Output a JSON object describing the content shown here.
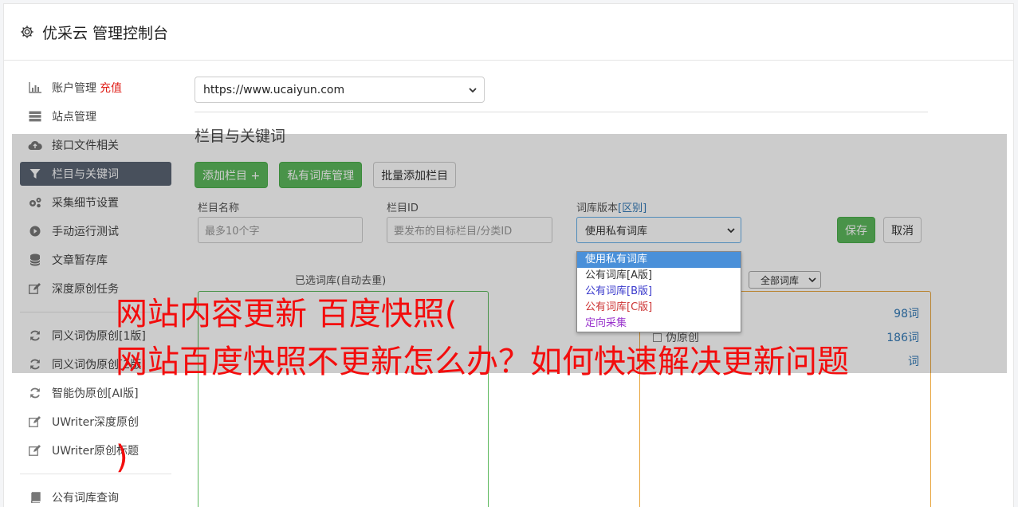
{
  "header": {
    "title": "优采云 管理控制台",
    "icon": "gear-icon"
  },
  "sidebar": {
    "items": [
      {
        "label": "账户管理",
        "extra": "充值",
        "icon": "bar-chart-icon"
      },
      {
        "label": "站点管理",
        "icon": "server-icon"
      },
      {
        "label": "接口文件相关",
        "icon": "cloud-upload-icon"
      },
      {
        "label": "栏目与关键词",
        "icon": "filter-icon",
        "active": true
      },
      {
        "label": "采集细节设置",
        "icon": "cogs-icon"
      },
      {
        "label": "手动运行测试",
        "icon": "play-icon"
      },
      {
        "label": "文章暂存库",
        "icon": "database-icon"
      },
      {
        "label": "深度原创任务",
        "icon": "edit-icon"
      },
      {
        "label": "同义词伪原创[1版]",
        "icon": "refresh-icon"
      },
      {
        "label": "同义词伪原创[2版]",
        "icon": "refresh-icon"
      },
      {
        "label": "智能伪原创[AI版]",
        "icon": "refresh-icon"
      },
      {
        "label": "UWriter深度原创",
        "icon": "edit-icon"
      },
      {
        "label": "UWriter原创标题",
        "icon": "edit-icon"
      },
      {
        "label": "公有词库查询",
        "icon": "book-icon"
      }
    ]
  },
  "main": {
    "site_select": "https://www.ucaiyun.com",
    "section_title": "栏目与关键词",
    "buttons": {
      "add_column": "添加栏目 +",
      "private_lib": "私有词库管理",
      "batch_add": "批量添加栏目"
    },
    "form": {
      "name_label": "栏目名称",
      "name_placeholder": "最多10个字",
      "id_label": "栏目ID",
      "id_placeholder": "要发布的目标栏目/分类ID",
      "version_label": "词库版本",
      "version_link": "[区别]",
      "version_value": "使用私有词库",
      "save": "保存",
      "cancel": "取消"
    },
    "dropdown_options": [
      {
        "label": "使用私有词库",
        "color": "#ffffff"
      },
      {
        "label": "公有词库[A版]",
        "color": "#333333"
      },
      {
        "label": "公有词库[B版]",
        "color": "#3a3acc"
      },
      {
        "label": "公有词库[C版]",
        "color": "#cc3333"
      },
      {
        "label": "定向采集",
        "color": "#9933cc"
      }
    ],
    "selected_label": "已选词库(自动去重)",
    "lib_filter": "全部词库",
    "libraries": [
      {
        "name": "",
        "count": "98词"
      },
      {
        "name": "伪原创",
        "count": "186词"
      },
      {
        "name": "",
        "count": "词"
      }
    ]
  },
  "banner": {
    "line1": "网站内容更新 百度快照(",
    "line2": "网站百度快照不更新怎么办？如何快速解决更新问题",
    "line3": ")"
  },
  "colors": {
    "accent_green": "#5cb85c",
    "active_nav": "#5a6474",
    "banner_red": "#f30d0d",
    "link_blue": "#337ab7"
  }
}
